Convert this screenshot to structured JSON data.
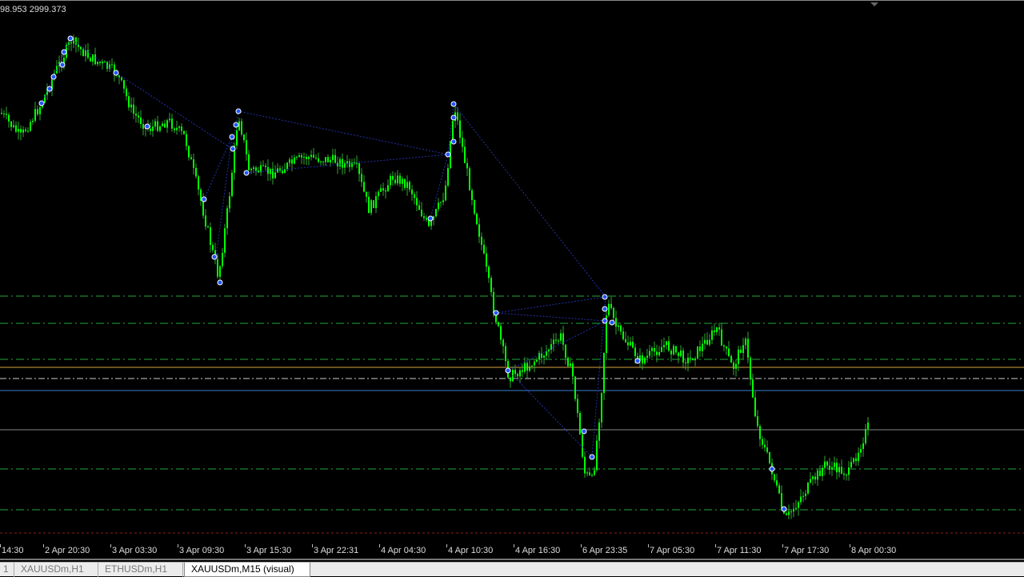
{
  "chart": {
    "price_readout": "98.953 2999.373",
    "time_labels": [
      "14:30",
      "2 Apr 20:30",
      "3 Apr 03:30",
      "3 Apr 09:30",
      "3 Apr 15:30",
      "3 Apr 22:31",
      "4 Apr 04:30",
      "4 Apr 10:30",
      "4 Apr 16:30",
      "6 Apr 23:35",
      "7 Apr 05:30",
      "7 Apr 11:30",
      "7 Apr 17:30",
      "8 Apr 00:30"
    ],
    "colors": {
      "background": "#000000",
      "candle": "#00ff00",
      "level_line": "#1faa3a",
      "orange_line": "#d9a441",
      "white_line": "#cccccc",
      "blue_line": "#3b7fd0",
      "gray_line": "#888888",
      "red_line": "#8b1a1a",
      "zigzag": "#2233aa",
      "marker": "#2255ff"
    }
  },
  "tabs": [
    {
      "label": "1"
    },
    {
      "label": "XAUUSDm,H1"
    },
    {
      "label": "ETHUSDm,H1"
    },
    {
      "label": "XAUUSDm,M15 (visual)",
      "active": true
    }
  ]
}
